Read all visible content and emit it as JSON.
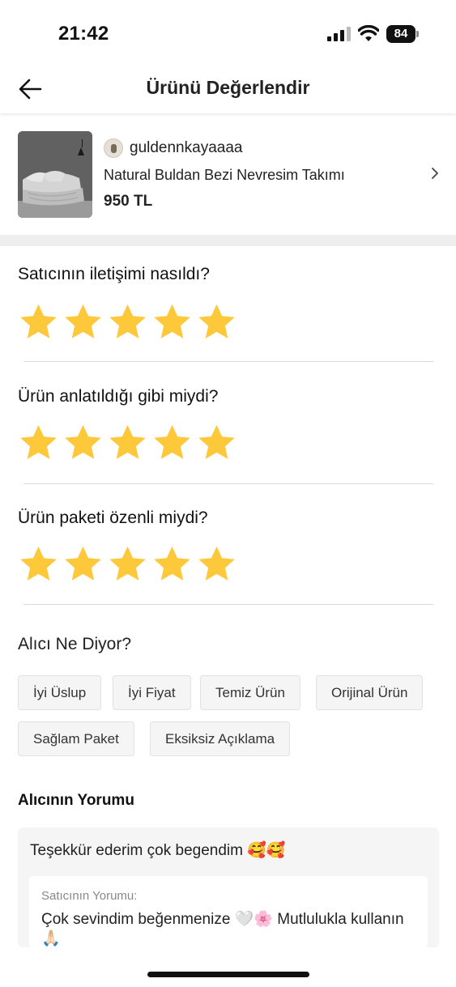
{
  "status_bar": {
    "time": "21:42",
    "battery": "84"
  },
  "nav": {
    "title": "Ürünü Değerlendir"
  },
  "product": {
    "seller": "guldennkayaaaa",
    "name": "Natural Buldan Bezi Nevresim Takımı",
    "price": "950 TL"
  },
  "ratings": [
    {
      "question": "Satıcının iletişimi nasıldı?",
      "stars": 5,
      "max": 5
    },
    {
      "question": "Ürün anlatıldığı gibi miydi?",
      "stars": 5,
      "max": 5
    },
    {
      "question": "Ürün paketi özenli miydi?",
      "stars": 5,
      "max": 5
    }
  ],
  "buyer_says": {
    "title": "Alıcı Ne Diyor?",
    "tags": [
      "İyi Üslup",
      "İyi Fiyat",
      "Temiz Ürün",
      "Orijinal Ürün",
      "Sağlam Paket",
      "Eksiksiz Açıklama"
    ]
  },
  "buyer_comment": {
    "title": "Alıcının Yorumu",
    "text": "Teşekkür ederim çok begendim 🥰🥰",
    "seller_reply_label": "Satıcının Yorumu:",
    "seller_reply": "Çok sevindim beğenmenize 🤍🌸 Mutlulukla kullanın 🙏🏻"
  },
  "colors": {
    "star": "#FDC83A",
    "tag_bg": "#F5F5F5",
    "divider": "#EEEEEE"
  }
}
